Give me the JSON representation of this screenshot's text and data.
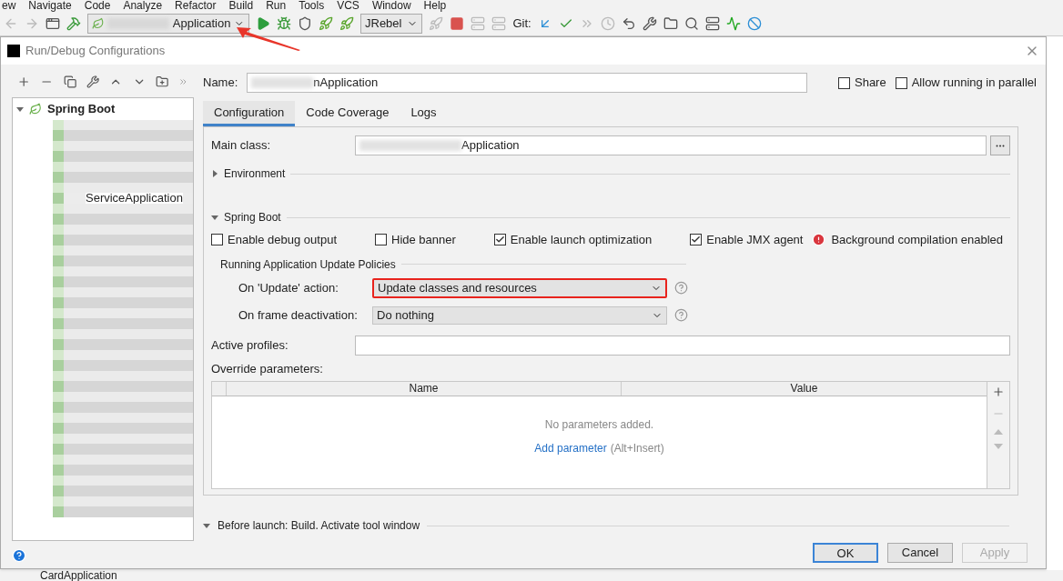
{
  "menu_bar": [
    "ew",
    "Navigate",
    "Code",
    "Analyze",
    "Refactor",
    "Build",
    "Run",
    "Tools",
    "VCS",
    "Window",
    "Help"
  ],
  "toolbar": {
    "run_config": "Application",
    "jrebel": "JRebel",
    "git_label": "Git:"
  },
  "dialog": {
    "title": "Run/Debug Configurations",
    "tree": [
      {
        "label": "Spring Boot",
        "expanded": true,
        "children": [
          {
            "label": "ServiceApplication"
          }
        ]
      }
    ],
    "name_label": "Name:",
    "name_value": "nApplication",
    "share": {
      "label": "Share",
      "checked": false
    },
    "parallel": {
      "label": "Allow running in parallel",
      "checked": false
    },
    "tabs": [
      {
        "label": "Configuration",
        "selected": true
      },
      {
        "label": "Code Coverage",
        "selected": false
      },
      {
        "label": "Logs",
        "selected": false
      }
    ],
    "main_class": {
      "label": "Main class:",
      "value": "Application"
    },
    "environment": {
      "label": "Environment",
      "expanded": false
    },
    "spring_boot": {
      "label": "Spring Boot",
      "expanded": true
    },
    "options": [
      {
        "label": "Enable debug output",
        "checked": false
      },
      {
        "label": "Hide banner",
        "checked": false
      },
      {
        "label": "Enable launch optimization",
        "checked": true
      },
      {
        "label": "Enable JMX agent",
        "checked": true
      }
    ],
    "warning": "Background compilation enabled",
    "policies_title": "Running Application Update Policies",
    "policies": [
      {
        "label": "On 'Update' action:",
        "value": "Update classes and resources",
        "highlighted": true
      },
      {
        "label": "On frame deactivation:",
        "value": "Do nothing",
        "highlighted": false
      }
    ],
    "active_profiles_label": "Active profiles:",
    "override_label": "Override parameters:",
    "table": {
      "columns": [
        "Name",
        "Value"
      ],
      "empty_text": "No parameters added.",
      "add_link": "Add parameter",
      "add_hint": "(Alt+Insert)"
    },
    "before_launch": "Before launch: Build. Activate tool window",
    "buttons": [
      {
        "label": "OK",
        "kind": "default"
      },
      {
        "label": "Cancel",
        "kind": "normal"
      },
      {
        "label": "Apply",
        "kind": "disabled"
      }
    ]
  },
  "background_item": "CardApplication"
}
